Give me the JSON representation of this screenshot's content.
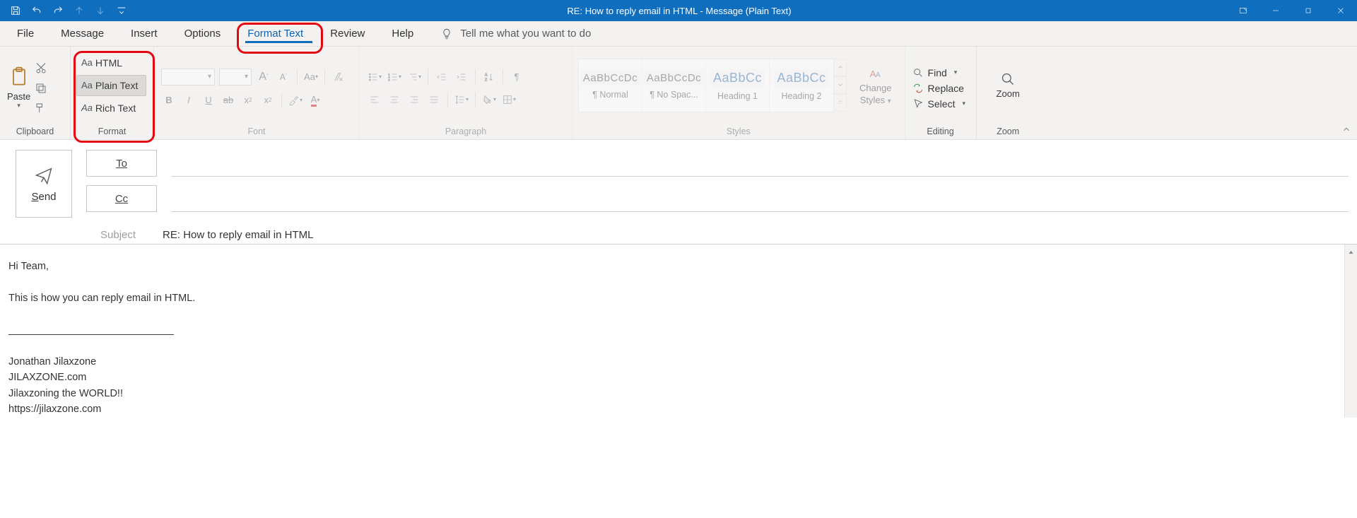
{
  "window": {
    "title": "RE: How to reply email in HTML  -  Message (Plain Text)"
  },
  "qat": {
    "save": "save-icon",
    "undo": "undo-icon",
    "redo": "redo-icon",
    "prev": "previous-item-icon",
    "next": "next-item-icon",
    "customize": "customize-qat-icon"
  },
  "tabs": {
    "file": "File",
    "message": "Message",
    "insert": "Insert",
    "options": "Options",
    "format_text": "Format Text",
    "review": "Review",
    "help": "Help",
    "tell_me": "Tell me what you want to do"
  },
  "ribbon": {
    "clipboard": {
      "label": "Clipboard",
      "paste": "Paste"
    },
    "format": {
      "label": "Format",
      "html": "HTML",
      "plain": "Plain Text",
      "rich": "Rich Text"
    },
    "font": {
      "label": "Font",
      "aa": "Aa"
    },
    "paragraph": {
      "label": "Paragraph"
    },
    "styles": {
      "label": "Styles",
      "change": "Change",
      "styles_line": "Styles",
      "preview": "AaBbCcDc",
      "preview_big": "AaBbCc",
      "items": [
        {
          "name": "¶ Normal"
        },
        {
          "name": "¶ No Spac..."
        },
        {
          "name": "Heading 1"
        },
        {
          "name": "Heading 2"
        }
      ]
    },
    "editing": {
      "label": "Editing",
      "find": "Find",
      "replace": "Replace",
      "select": "Select"
    },
    "zoom": {
      "label": "Zoom",
      "btn": "Zoom"
    }
  },
  "compose": {
    "send": "Send",
    "to": "To",
    "cc": "Cc",
    "subject_label": "Subject",
    "subject_value": "RE: How to reply email in HTML"
  },
  "body": {
    "line1": "Hi Team,",
    "line2": "This is how you can reply email in HTML.",
    "sep": "_____________________________",
    "sig1": "Jonathan Jilaxzone",
    "sig2": "JILAXZONE.com",
    "sig3": "Jilaxzoning the WORLD!!",
    "sig4": "https://jilaxzone.com"
  }
}
